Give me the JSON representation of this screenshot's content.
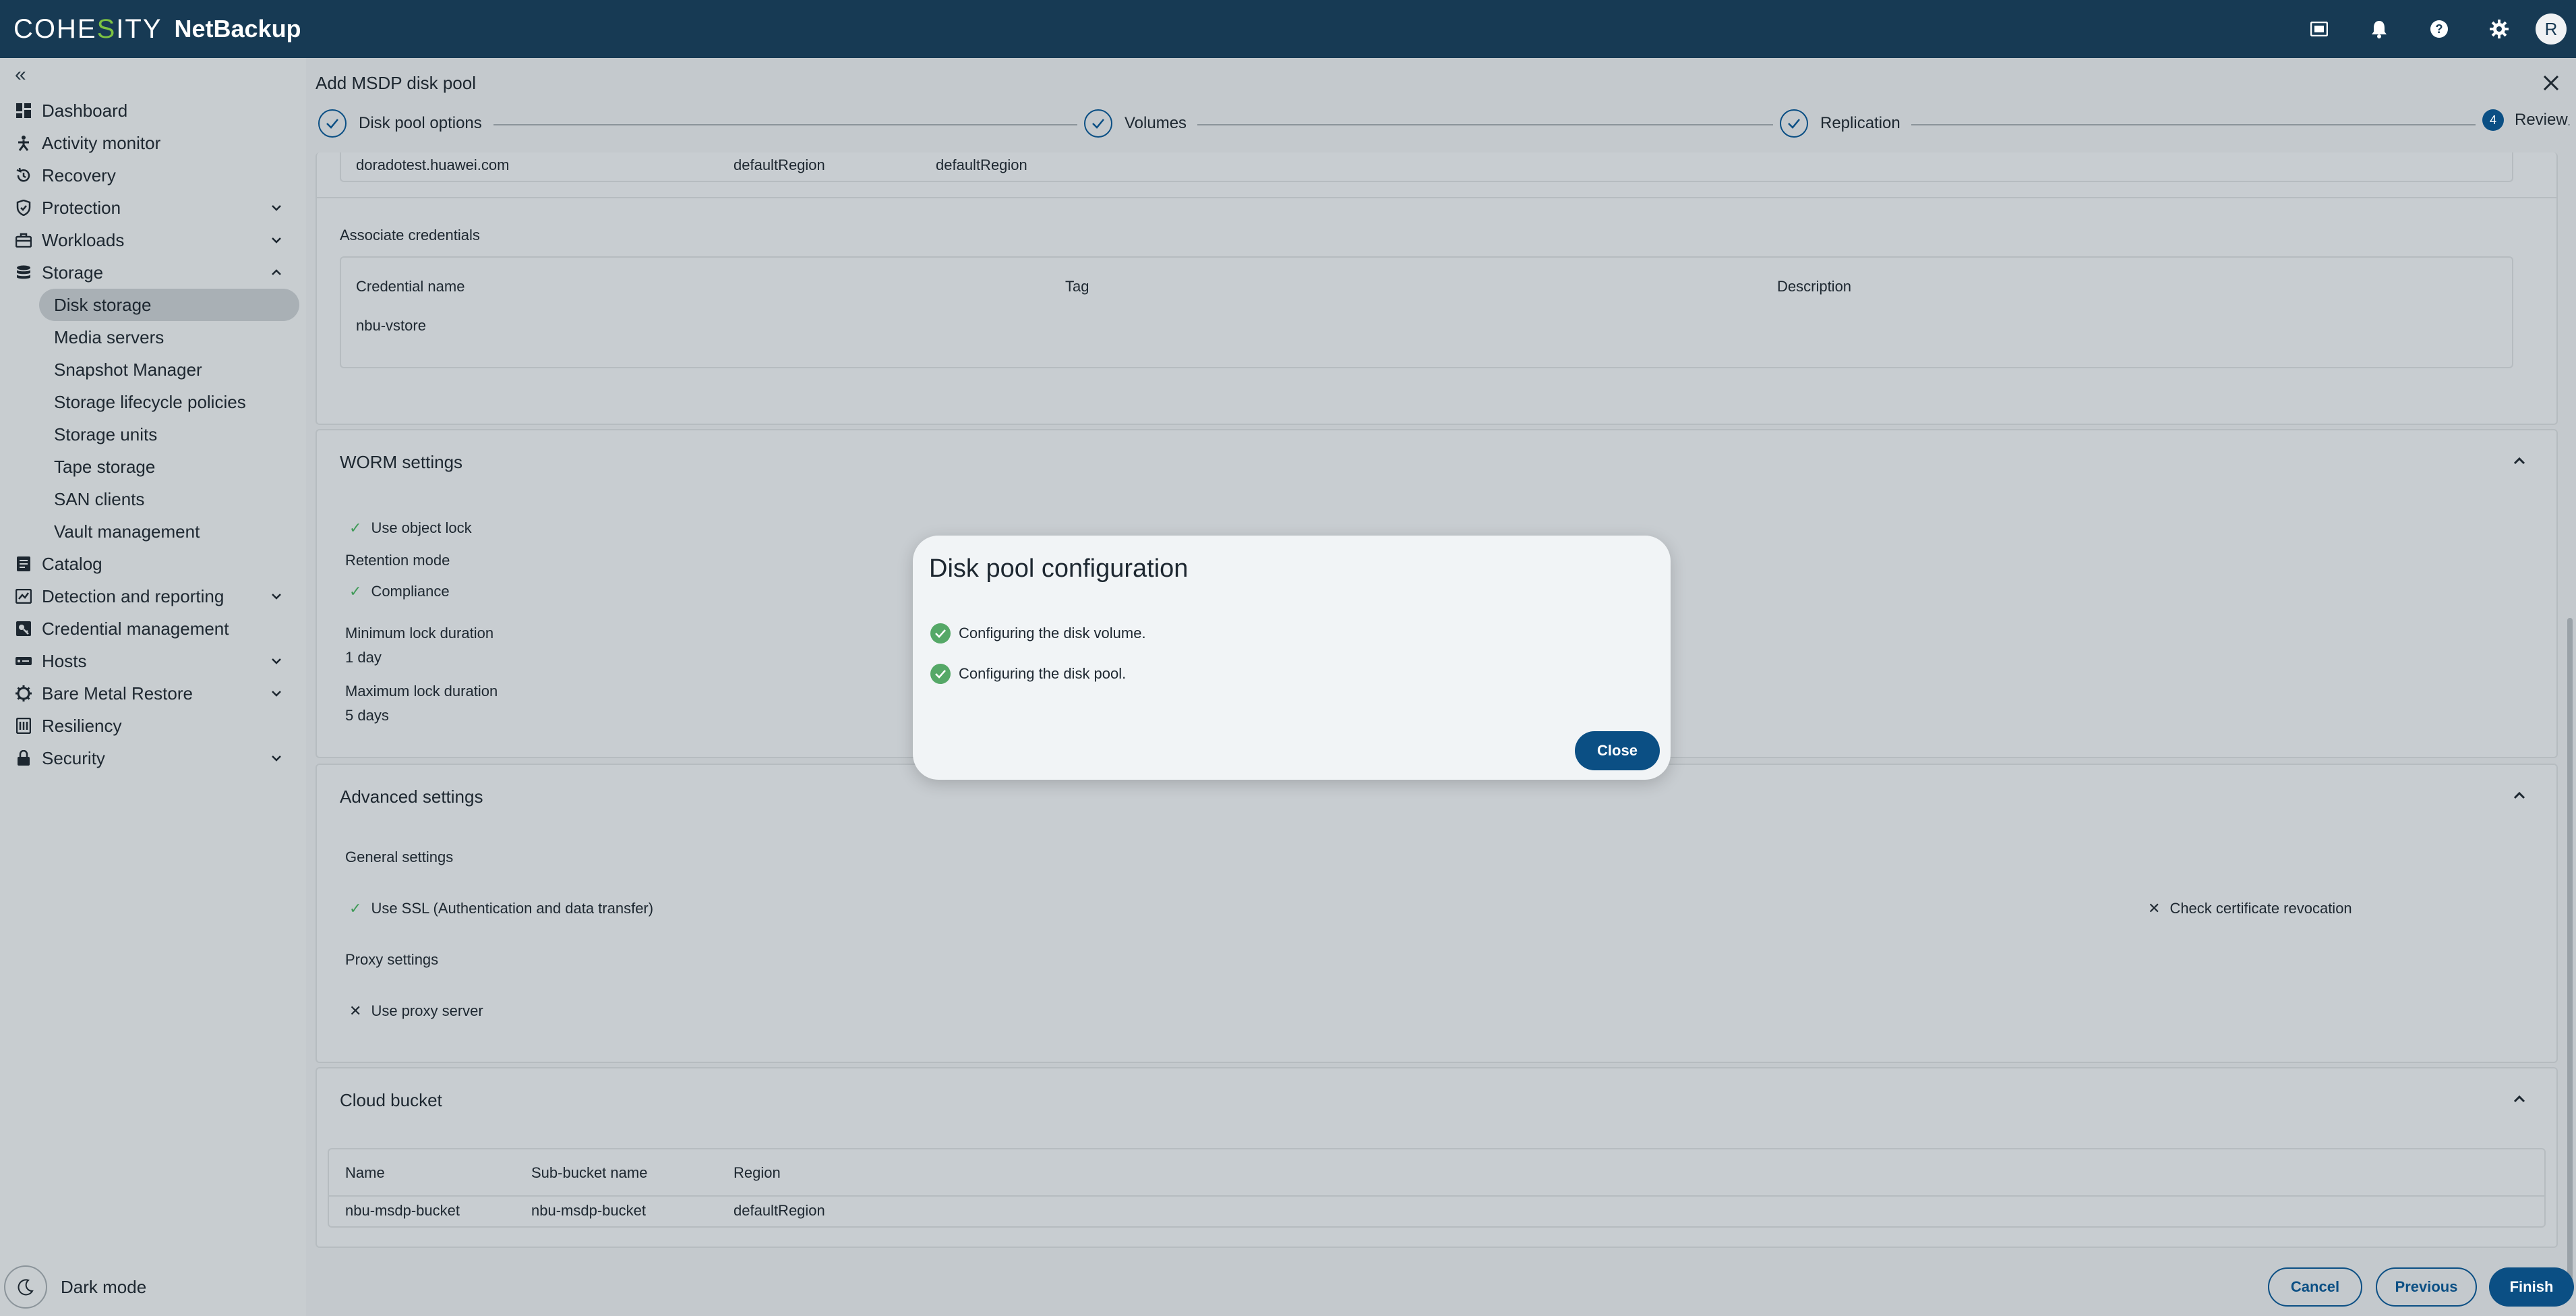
{
  "brand": {
    "logo_prefix": "COHE",
    "logo_s": "S",
    "logo_suffix": "ITY",
    "product": "NetBackup"
  },
  "topbar": {
    "icons": [
      "grid-apps-icon",
      "bell-icon",
      "help-icon",
      "gear-icon"
    ],
    "avatar_initial": "R"
  },
  "sidebar": {
    "collapse_label": "«",
    "items": [
      {
        "label": "Dashboard",
        "icon": "dashboard-icon"
      },
      {
        "label": "Activity monitor",
        "icon": "activity-icon"
      },
      {
        "label": "Recovery",
        "icon": "recovery-icon"
      },
      {
        "label": "Protection",
        "icon": "shield-icon"
      },
      {
        "label": "Workloads",
        "icon": "workloads-icon"
      },
      {
        "label": "Storage",
        "icon": "storage-icon"
      },
      {
        "label": "Catalog",
        "icon": "catalog-icon"
      },
      {
        "label": "Detection and reporting",
        "icon": "detection-icon"
      },
      {
        "label": "Credential management",
        "icon": "credential-icon"
      },
      {
        "label": "Hosts",
        "icon": "hosts-icon"
      },
      {
        "label": "Bare Metal Restore",
        "icon": "bmr-icon"
      },
      {
        "label": "Resiliency",
        "icon": "resiliency-icon"
      },
      {
        "label": "Security",
        "icon": "lock-icon"
      }
    ],
    "storage_sub": [
      "Disk storage",
      "Media servers",
      "Snapshot Manager",
      "Storage lifecycle policies",
      "Storage units",
      "Tape storage",
      "SAN clients",
      "Vault management"
    ],
    "dark_mode": "Dark mode"
  },
  "wizard": {
    "title": "Add MSDP disk pool",
    "steps": [
      {
        "label": "Disk pool options",
        "state": "done"
      },
      {
        "label": "Volumes",
        "state": "done"
      },
      {
        "label": "Replication",
        "state": "done"
      },
      {
        "label": "Review",
        "state": "current",
        "number": "4"
      }
    ]
  },
  "review": {
    "server_row": {
      "host": "doradotest.huawei.com",
      "region1": "defaultRegion",
      "region2": "defaultRegion"
    },
    "assoc_title": "Associate credentials",
    "cred_headers": {
      "name": "Credential name",
      "tag": "Tag",
      "description": "Description"
    },
    "cred_row": {
      "name": "nbu-vstore"
    },
    "worm": {
      "title": "WORM settings",
      "use_object_lock": "Use object lock",
      "retention_mode_label": "Retention mode",
      "retention_mode_value": "Compliance",
      "min_label": "Minimum lock duration",
      "min_value": "1 day",
      "max_label": "Maximum lock duration",
      "max_value": "5 days"
    },
    "advanced": {
      "title": "Advanced settings",
      "general_label": "General settings",
      "use_ssl": "Use SSL (Authentication and data transfer)",
      "check_cert": "Check certificate revocation",
      "proxy_label": "Proxy settings",
      "use_proxy": "Use proxy server"
    },
    "bucket": {
      "title": "Cloud bucket",
      "headers": {
        "name": "Name",
        "sub": "Sub-bucket name",
        "region": "Region"
      },
      "row": {
        "name": "nbu-msdp-bucket",
        "sub": "nbu-msdp-bucket",
        "region": "defaultRegion"
      }
    }
  },
  "footer": {
    "cancel": "Cancel",
    "previous": "Previous",
    "finish": "Finish"
  },
  "modal": {
    "title": "Disk pool configuration",
    "rows": [
      "Configuring the disk volume.",
      "Configuring the disk pool."
    ],
    "close": "Close"
  },
  "colors": {
    "topbar": "#173a54",
    "primary": "#0b4f84",
    "success": "#55a867",
    "brand_s": "#7cc242"
  }
}
